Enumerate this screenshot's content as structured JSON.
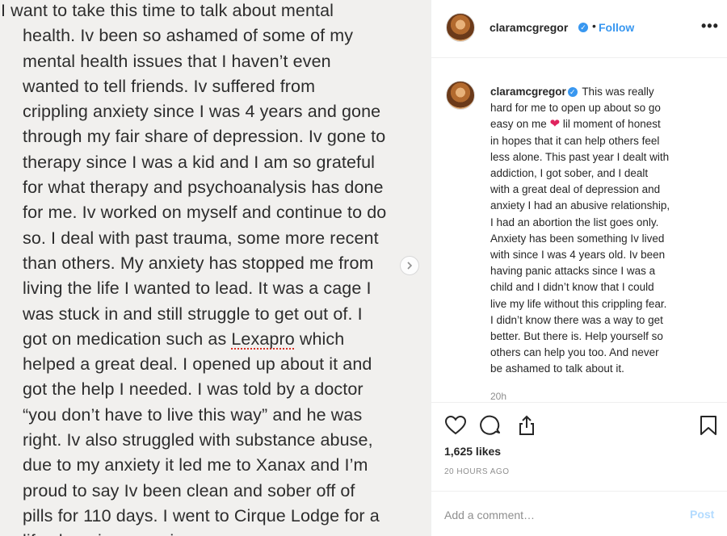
{
  "photo": {
    "lines": [
      "I  want to take this time to talk about mental",
      "health. Iv been so ashamed of some of my",
      "mental health issues that I haven’t even",
      "wanted to tell friends. Iv suffered from",
      "crippling anxiety since I was 4 years and gone",
      "through my fair share of depression. Iv gone to",
      "therapy since I was a kid and I am so grateful",
      "for what therapy and psychoanalysis has done",
      "for me. Iv worked on myself and continue to do",
      "so. I deal with past trauma, some more recent",
      "than others. My anxiety has stopped me from",
      "living the life I wanted to lead. It was a cage I",
      "was stuck in and still struggle to get out of. I",
      "got on medication such as ",
      "helped a great deal. I opened up about it and",
      "got the help I needed. I was told by a doctor",
      "“you don’t have to live this way” and he was",
      "right. Iv also struggled with substance abuse,",
      "due to my anxiety it led me to Xanax and I’m",
      "proud to say Iv been clean and sober off of",
      "pills for 110 days. I went to Cirque Lodge for a",
      "life changing experience"
    ],
    "misspelled_word": "Lexapro",
    "after_misspelled": " which",
    "next_icon": "chevron-right-icon"
  },
  "header": {
    "username": "claramcgregor",
    "dot": "•",
    "follow_label": "Follow",
    "more_label": "•••"
  },
  "caption": {
    "username": "claramcgregor",
    "lines": [
      "This was really",
      "hard for me to open up about so go",
      "easy on me",
      "lil moment of honest",
      "in hopes that it can help others feel",
      "less alone. This past year I dealt with",
      "addiction, I got sober, and I dealt",
      "with a great deal of depression and",
      "anxiety I had an abusive relationship,",
      "I had an abortion the list goes only.",
      "Anxiety has been something Iv lived",
      "with since I was 4 years old. Iv been",
      "having panic attacks since I was a",
      "child and I didn’t know that I could",
      "live my life without this crippling fear.",
      "I didn’t know there was a way to get",
      "better. But there is. Help yourself so",
      "others can help you too. And never",
      "be ashamed to talk about it."
    ],
    "heart_emoji": "❤",
    "time": "20h"
  },
  "actions": {
    "likes": "1,625 likes",
    "ago": "20 HOURS AGO",
    "icons": [
      "heart-icon",
      "comment-icon",
      "share-icon",
      "bookmark-icon"
    ]
  },
  "comment": {
    "placeholder": "Add a comment…",
    "post_label": "Post"
  },
  "colors": {
    "accent": "#3897f0",
    "post_disabled": "#b3dbff",
    "text": "#262626",
    "muted": "#8e8e8e",
    "photo_bg": "#f1f0ee"
  }
}
